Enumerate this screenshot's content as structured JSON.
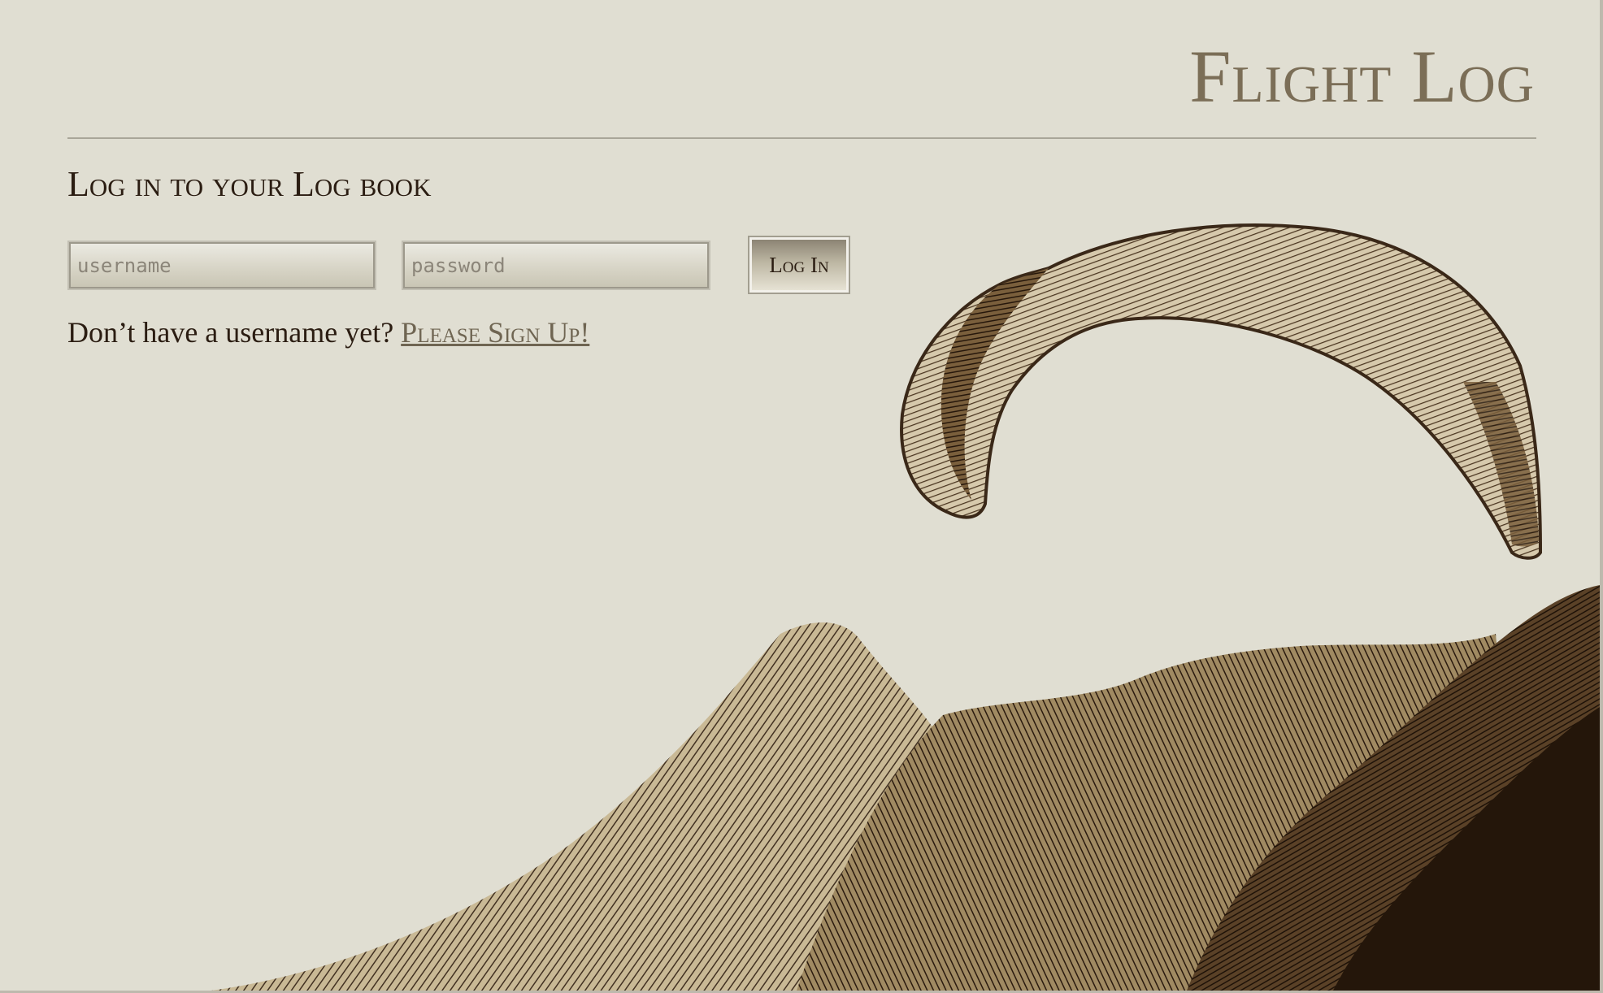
{
  "app": {
    "title": "Flight Log"
  },
  "login": {
    "heading": "Log in to your Log book",
    "username_placeholder": "username",
    "password_placeholder": "password",
    "submit_label": "Log In"
  },
  "signup": {
    "prompt": "Don’t have a username yet? ",
    "link_label": "Please Sign Up!"
  },
  "illustration": {
    "icon": "paraglider-over-mountains-illustration"
  },
  "colors": {
    "background": "#e0ded2",
    "title": "#7b6e57",
    "text": "#2b1d12",
    "ink": "#3a2818"
  }
}
